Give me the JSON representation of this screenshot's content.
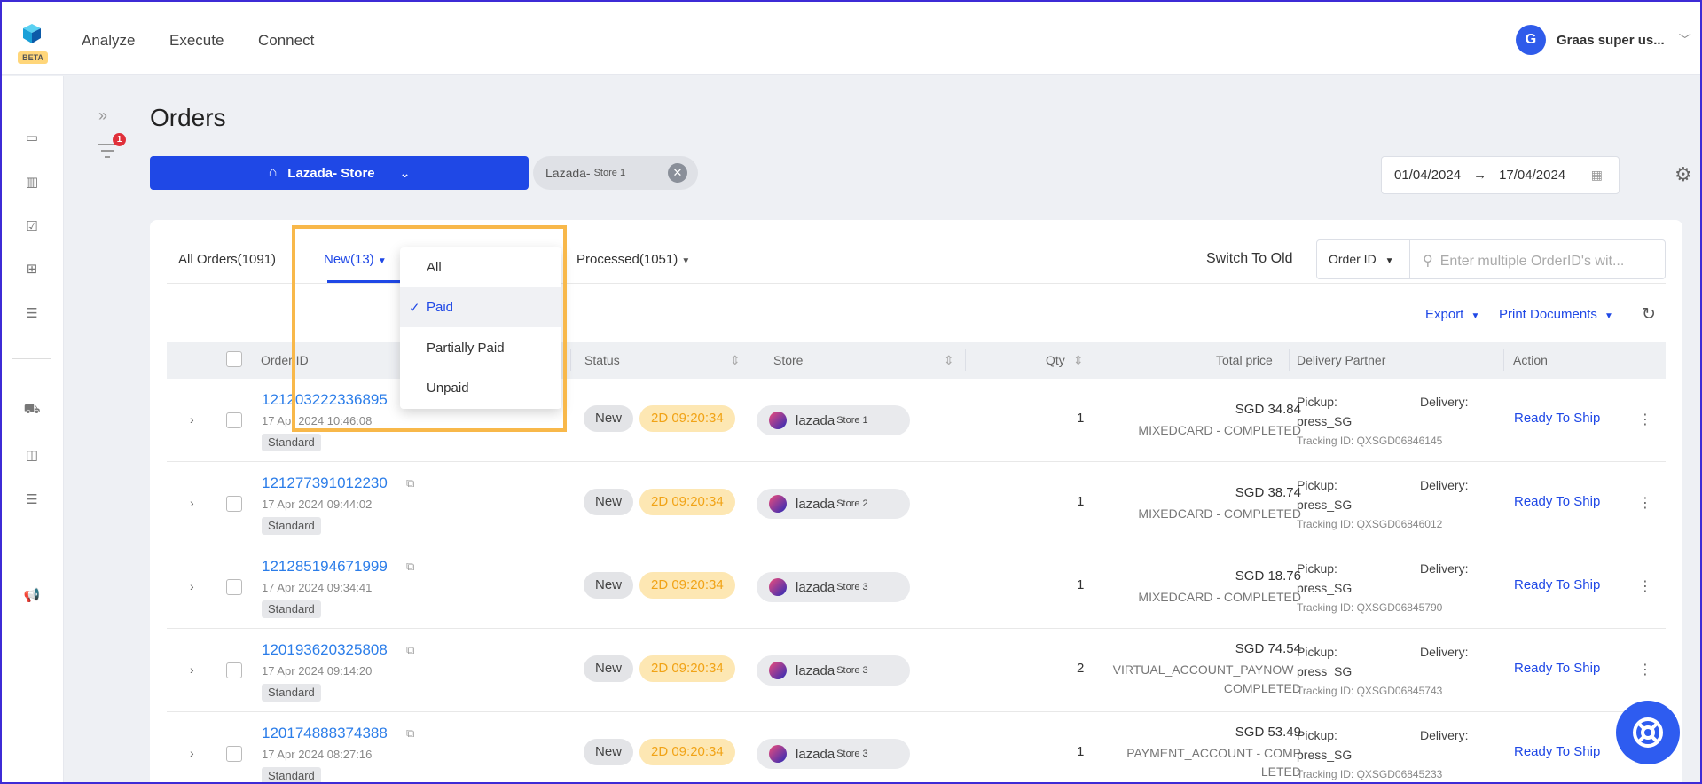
{
  "topbar": {
    "beta_label": "BETA",
    "nav": [
      "Analyze",
      "Execute",
      "Connect"
    ],
    "user_initial": "G",
    "user_name": "Graas super us...",
    "accent": "#1f48e6"
  },
  "page": {
    "title": "Orders",
    "filter_badge": "1",
    "store_button_label": "Lazada- Store",
    "store_chip": {
      "prefix": "Lazada-",
      "suffix": "Store 1"
    },
    "date_from": "01/04/2024",
    "date_to": "17/04/2024"
  },
  "tabs": {
    "all": "All Orders(1091)",
    "new": "New(13)",
    "processed": "Processed(1051)"
  },
  "toolbar": {
    "switch_old": "Switch To Old",
    "search_by": "Order ID",
    "search_placeholder": "Enter multiple OrderID's wit...",
    "export": "Export",
    "print": "Print Documents"
  },
  "dropdown": {
    "items": [
      "All",
      "Paid",
      "Partially Paid",
      "Unpaid"
    ],
    "selected": "Paid"
  },
  "table": {
    "headers": {
      "order_id": "Order ID",
      "status": "Status",
      "store": "Store",
      "qty": "Qty",
      "total": "Total price",
      "delivery": "Delivery Partner",
      "action": "Action"
    },
    "rows": [
      {
        "id": "121203222336895",
        "date": "17 Apr 2024 10:46:08",
        "type": "Standard",
        "status": "New",
        "timer": "2D 09:20:34",
        "store": "lazada",
        "store_sub": "Store 1",
        "qty": "1",
        "price": "SGD 34.84",
        "pay": "MIXEDCARD - COMPLETED",
        "pickup": "Pickup:",
        "delivery": "Delivery:",
        "partner": "press_SG",
        "tracking": "Tracking ID: QXSGD06846145",
        "action": "Ready To Ship"
      },
      {
        "id": "121277391012230",
        "date": "17 Apr 2024 09:44:02",
        "type": "Standard",
        "status": "New",
        "timer": "2D 09:20:34",
        "store": "lazada",
        "store_sub": "Store 2",
        "qty": "1",
        "price": "SGD 38.74",
        "pay": "MIXEDCARD - COMPLETED",
        "pickup": "Pickup:",
        "delivery": "Delivery:",
        "partner": "press_SG",
        "tracking": "Tracking ID: QXSGD06846012",
        "action": "Ready To Ship"
      },
      {
        "id": "121285194671999",
        "date": "17 Apr 2024 09:34:41",
        "type": "Standard",
        "status": "New",
        "timer": "2D 09:20:34",
        "store": "lazada",
        "store_sub": "Store 3",
        "qty": "1",
        "price": "SGD 18.76",
        "pay": "MIXEDCARD - COMPLETED",
        "pickup": "Pickup:",
        "delivery": "Delivery:",
        "partner": "press_SG",
        "tracking": "Tracking ID: QXSGD06845790",
        "action": "Ready To Ship"
      },
      {
        "id": "120193620325808",
        "date": "17 Apr 2024 09:14:20",
        "type": "Standard",
        "status": "New",
        "timer": "2D 09:20:34",
        "store": "lazada",
        "store_sub": "Store 3",
        "qty": "2",
        "price": "SGD 74.54",
        "pay": "VIRTUAL_ACCOUNT_PAYNOW - COMPLETED",
        "pickup": "Pickup:",
        "delivery": "Delivery:",
        "partner": "press_SG",
        "tracking": "Tracking ID: QXSGD06845743",
        "action": "Ready To Ship"
      },
      {
        "id": "120174888374388",
        "date": "17 Apr 2024 08:27:16",
        "type": "Standard",
        "status": "New",
        "timer": "2D 09:20:34",
        "store": "lazada",
        "store_sub": "Store 3",
        "qty": "1",
        "price": "SGD 53.49",
        "pay": "PAYMENT_ACCOUNT - COMP LETED",
        "pickup": "Pickup:",
        "delivery": "Delivery:",
        "partner": "press_SG",
        "tracking": "Tracking ID: QXSGD06845233",
        "action": "Ready To Ship"
      }
    ]
  }
}
